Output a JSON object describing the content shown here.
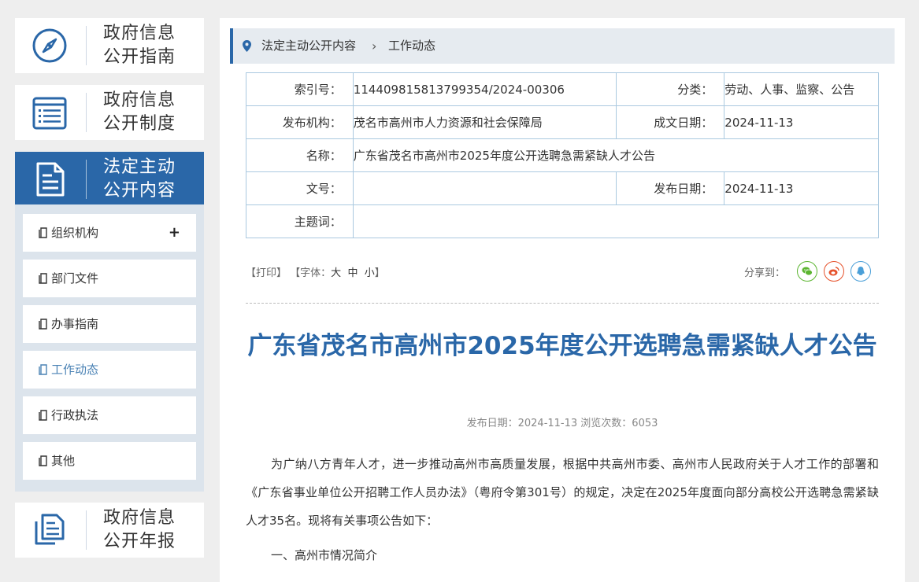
{
  "sidebar": {
    "cards": [
      {
        "label": "政府信息公开指南",
        "icon": "compass-icon"
      },
      {
        "label": "政府信息公开制度",
        "icon": "list-document-icon"
      },
      {
        "label": "法定主动公开内容",
        "icon": "document-icon"
      },
      {
        "label": "政府信息公开年报",
        "icon": "report-icon"
      }
    ],
    "subitems": [
      {
        "label": "组织机构",
        "expand": "+"
      },
      {
        "label": "部门文件"
      },
      {
        "label": "办事指南"
      },
      {
        "label": "工作动态"
      },
      {
        "label": "行政执法"
      },
      {
        "label": "其他"
      }
    ]
  },
  "breadcrumb": {
    "items": [
      "法定主动公开内容",
      "工作动态"
    ],
    "separator": "›"
  },
  "meta": {
    "index_label": "索引号：",
    "index_value": "114409815813799354/2024-00306",
    "category_label": "分类：",
    "category_value": "劳动、人事、监察、公告",
    "publisher_label": "发布机构：",
    "publisher_value": "茂名市高州市人力资源和社会保障局",
    "created_label": "成文日期：",
    "created_value": "2024-11-13",
    "name_label": "名称：",
    "name_value": "广东省茂名市高州市2025年度公开选聘急需紧缺人才公告",
    "docno_label": "文号：",
    "docno_value": "",
    "pubdate_label": "发布日期：",
    "pubdate_value": "2024-11-13",
    "keywords_label": "主题词：",
    "keywords_value": ""
  },
  "tools": {
    "print": "【打印】",
    "font_prefix": "【字体：",
    "font_large": "大",
    "font_medium": "中",
    "font_small": "小",
    "font_suffix": "】",
    "share_label": "分享到："
  },
  "share_colors": {
    "wechat": "#5cb531",
    "weibo": "#e6522c",
    "qq": "#4a9fd8"
  },
  "article": {
    "title": "广东省茂名市高州市2025年度公开选聘急需紧缺人才公告",
    "pubinfo": "发布日期：2024-11-13  浏览次数：6053",
    "paragraphs": [
      "为广纳八方青年人才，进一步推动高州市高质量发展，根据中共高州市委、高州市人民政府关于人才工作的部署和《广东省事业单位公开招聘工作人员办法》（粤府令第301号）的规定，决定在2025年度面向部分高校公开选聘急需紧缺人才35名。现将有关事项公告如下：",
      "一、高州市情况简介"
    ]
  },
  "colors": {
    "accent": "#2a67a8",
    "title": "#2a67a8",
    "table_border": "#aac9e0"
  }
}
